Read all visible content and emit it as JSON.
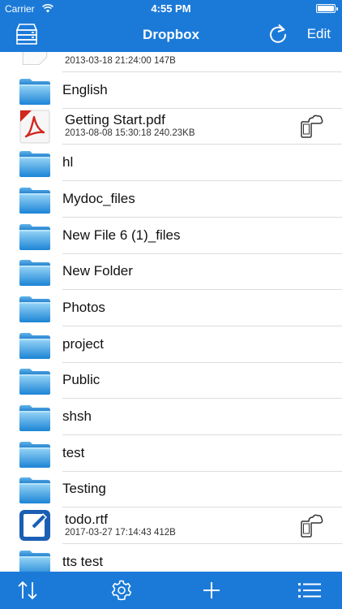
{
  "status": {
    "carrier": "Carrier",
    "time": "4:55 PM"
  },
  "nav": {
    "title": "Dropbox",
    "edit_label": "Edit"
  },
  "files": [
    {
      "type": "note",
      "name": "",
      "meta": "2013-03-18 21:24:00  147B",
      "partial": true
    },
    {
      "type": "folder",
      "name": "English"
    },
    {
      "type": "pdf",
      "name": "Getting Start.pdf",
      "meta": "2013-08-08 15:30:18  240.23KB"
    },
    {
      "type": "folder",
      "name": "hl"
    },
    {
      "type": "folder",
      "name": "Mydoc_files"
    },
    {
      "type": "folder",
      "name": "New File 6 (1)_files"
    },
    {
      "type": "folder",
      "name": "New Folder"
    },
    {
      "type": "folder",
      "name": "Photos"
    },
    {
      "type": "folder",
      "name": "project"
    },
    {
      "type": "folder",
      "name": "Public"
    },
    {
      "type": "folder",
      "name": "shsh"
    },
    {
      "type": "folder",
      "name": "test"
    },
    {
      "type": "folder",
      "name": "Testing"
    },
    {
      "type": "rtf",
      "name": "todo.rtf",
      "meta": "2017-03-27 17:14:43  412B"
    },
    {
      "type": "folder",
      "name": "tts test"
    }
  ],
  "colors": {
    "bar": "#1b7ad8",
    "folder_light": "#8fd0f5",
    "folder_dark": "#1f88d8"
  }
}
